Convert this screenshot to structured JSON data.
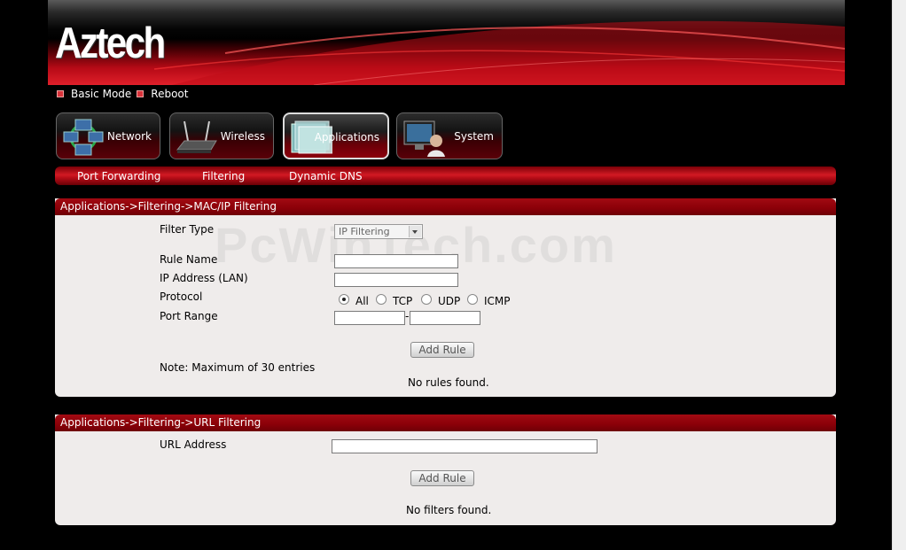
{
  "brand": {
    "logo_text": "Aztech"
  },
  "top_links": [
    "Basic Mode",
    "Reboot"
  ],
  "main_nav": [
    {
      "label": "Network",
      "icon": "network-icon"
    },
    {
      "label": "Wireless",
      "icon": "router-icon"
    },
    {
      "label": "Applications",
      "icon": "applications-icon",
      "active": true
    },
    {
      "label": "System",
      "icon": "system-icon"
    }
  ],
  "sub_nav": [
    "Port Forwarding",
    "Filtering",
    "Dynamic DNS"
  ],
  "mac_panel": {
    "title": "Applications->Filtering->MAC/IP Filtering",
    "filter_type_label": "Filter Type",
    "filter_type_value": "IP Filtering",
    "rule_name_label": "Rule Name",
    "ip_label": "IP Address (LAN)",
    "protocol_label": "Protocol",
    "protocol_options": [
      "All",
      "TCP",
      "UDP",
      "ICMP"
    ],
    "protocol_selected": "All",
    "port_range_label": "Port Range",
    "port_separator": "-",
    "add_rule": "Add Rule",
    "note": "Note: Maximum of 30 entries",
    "empty_text": "No rules found."
  },
  "url_panel": {
    "title": "Applications->Filtering->URL Filtering",
    "url_label": "URL Address",
    "add_rule": "Add Rule",
    "empty_text": "No filters found."
  },
  "watermark": "PcWinTech.com",
  "colors": {
    "accent_red": "#c8101c",
    "panel_bg": "#efeceb",
    "page_bg": "#000000"
  }
}
